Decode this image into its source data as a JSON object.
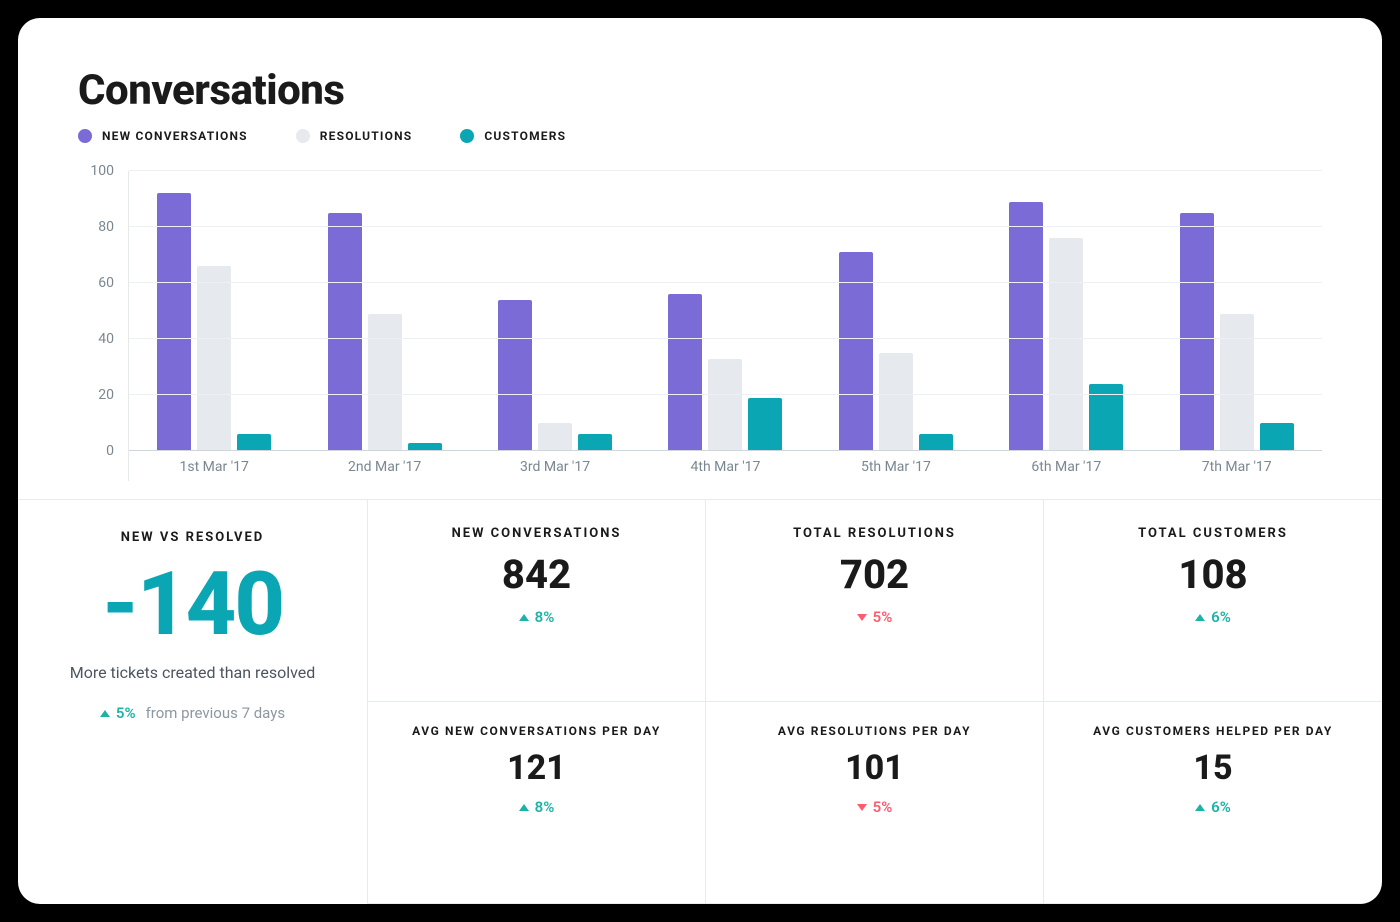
{
  "title": "Conversations",
  "legend": [
    {
      "label": "NEW CONVERSATIONS",
      "color": "#7a6bd6"
    },
    {
      "label": "RESOLUTIONS",
      "color": "#e6e9ee"
    },
    {
      "label": "CUSTOMERS",
      "color": "#0aa6b3"
    }
  ],
  "big_metric": {
    "label": "NEW VS RESOLVED",
    "value": "-140",
    "caption": "More tickets created than resolved",
    "delta": {
      "dir": "up",
      "pct": "5%",
      "suffix": "from previous 7 days"
    }
  },
  "metrics_top": [
    {
      "label": "NEW CONVERSATIONS",
      "value": "842",
      "delta": {
        "dir": "up",
        "pct": "8%"
      }
    },
    {
      "label": "TOTAL RESOLUTIONS",
      "value": "702",
      "delta": {
        "dir": "down",
        "pct": "5%"
      }
    },
    {
      "label": "TOTAL CUSTOMERS",
      "value": "108",
      "delta": {
        "dir": "up",
        "pct": "6%"
      }
    }
  ],
  "metrics_bottom": [
    {
      "label": "AVG NEW CONVERSATIONS PER DAY",
      "value": "121",
      "delta": {
        "dir": "up",
        "pct": "8%"
      }
    },
    {
      "label": "AVG RESOLUTIONS PER DAY",
      "value": "101",
      "delta": {
        "dir": "down",
        "pct": "5%"
      }
    },
    {
      "label": "AVG CUSTOMERS HELPED PER DAY",
      "value": "15",
      "delta": {
        "dir": "up",
        "pct": "6%"
      }
    }
  ],
  "chart_data": {
    "type": "bar",
    "title": "Conversations",
    "ylabel": "",
    "xlabel": "",
    "ylim": [
      0,
      100
    ],
    "y_ticks": [
      0,
      20,
      40,
      60,
      80,
      100
    ],
    "categories": [
      "1st Mar '17",
      "2nd Mar '17",
      "3rd Mar '17",
      "4th Mar '17",
      "5th Mar '17",
      "6th Mar '17",
      "7th Mar '17"
    ],
    "series": [
      {
        "name": "NEW CONVERSATIONS",
        "color": "#7a6bd6",
        "values": [
          92,
          85,
          54,
          56,
          71,
          89,
          85
        ]
      },
      {
        "name": "RESOLUTIONS",
        "color": "#e6e9ee",
        "values": [
          66,
          49,
          10,
          33,
          35,
          76,
          49
        ]
      },
      {
        "name": "CUSTOMERS",
        "color": "#0aa6b3",
        "values": [
          6,
          3,
          6,
          19,
          6,
          24,
          10
        ]
      }
    ]
  }
}
